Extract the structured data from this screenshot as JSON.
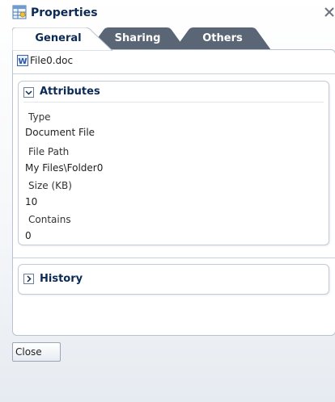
{
  "dialog": {
    "title": "Properties",
    "icon": "properties-table-icon",
    "close_icon": "close-icon"
  },
  "tabs": [
    {
      "label": "General",
      "active": true
    },
    {
      "label": "Sharing",
      "active": false
    },
    {
      "label": "Others",
      "active": false
    }
  ],
  "file": {
    "name": "File0.doc",
    "icon": "word-document-icon"
  },
  "attributes": {
    "title": "Attributes",
    "expanded": true,
    "fields": [
      {
        "label": "Type",
        "value": "Document File"
      },
      {
        "label": "File Path",
        "value": "My Files\\Folder0"
      },
      {
        "label": "Size (KB)",
        "value": "10"
      },
      {
        "label": "Contains",
        "value": "0"
      }
    ]
  },
  "history": {
    "title": "History",
    "expanded": false
  },
  "footer": {
    "close_label": "Close"
  },
  "colors": {
    "title_text": "#0b2a55",
    "active_tab": "#ffffff",
    "inactive_tab": "#5a6675",
    "border": "#b9c3cf"
  }
}
